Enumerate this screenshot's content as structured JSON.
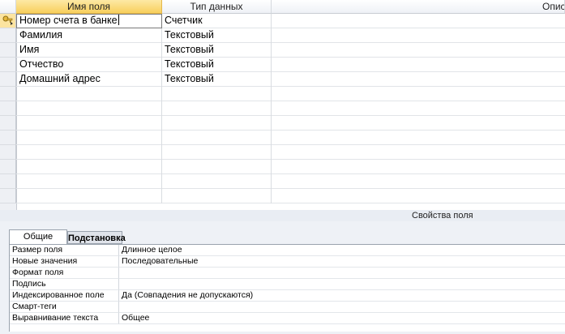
{
  "grid": {
    "headers": {
      "field_name": "Имя поля",
      "data_type": "Тип данных",
      "description": "Опис"
    },
    "rows": [
      {
        "name": "Номер счета в банке",
        "type": "Счетчик"
      },
      {
        "name": "Фамилия",
        "type": "Текстовый"
      },
      {
        "name": "Имя",
        "type": "Текстовый"
      },
      {
        "name": "Отчество",
        "type": "Текстовый"
      },
      {
        "name": "Домашний адрес",
        "type": "Текстовый"
      }
    ]
  },
  "properties": {
    "caption": "Свойства поля",
    "tabs": {
      "general": "Общие",
      "lookup": "Подстановка"
    },
    "rows": [
      {
        "label": "Размер поля",
        "value": "Длинное целое"
      },
      {
        "label": "Новые значения",
        "value": "Последовательные"
      },
      {
        "label": "Формат поля",
        "value": ""
      },
      {
        "label": "Подпись",
        "value": ""
      },
      {
        "label": "Индексированное поле",
        "value": "Да (Совпадения не допускаются)"
      },
      {
        "label": "Смарт-теги",
        "value": ""
      },
      {
        "label": "Выравнивание текста",
        "value": "Общее"
      }
    ]
  },
  "colors": {
    "selected_header": "#f8cf5d",
    "grid_line": "#d9dce1",
    "panel_bg": "#eef1f6"
  }
}
